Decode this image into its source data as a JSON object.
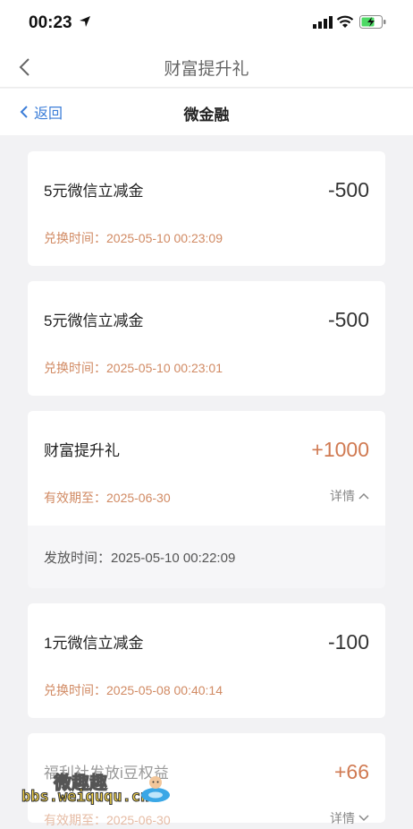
{
  "status_bar": {
    "time": "00:23"
  },
  "nav": {
    "title": "财富提升礼"
  },
  "sub_header": {
    "back_label": "返回",
    "title": "微金融"
  },
  "records": [
    {
      "title": "5元微信立减金",
      "amount": "-500",
      "sub": "兑换时间：2025-05-10 00:23:09"
    },
    {
      "title": "5元微信立减金",
      "amount": "-500",
      "sub": "兑换时间：2025-05-10 00:23:01"
    },
    {
      "title": "财富提升礼",
      "amount": "+1000",
      "sub": "有效期至：2025-06-30",
      "detail": "详情",
      "extra": "发放时间：2025-05-10 00:22:09"
    },
    {
      "title": "1元微信立减金",
      "amount": "-100",
      "sub": "兑换时间：2025-05-08 00:40:14"
    },
    {
      "title": "福利社发放i豆权益",
      "amount": "+66",
      "sub": "有效期至：2025-06-30",
      "detail": "详情"
    }
  ],
  "watermark": {
    "cn": "微趣趣",
    "url": "bbs.weiququ.cn"
  },
  "colors": {
    "accent_blue": "#3b7dd8",
    "plus_amount": "#d07a52",
    "sub_text": "#d18a63"
  }
}
